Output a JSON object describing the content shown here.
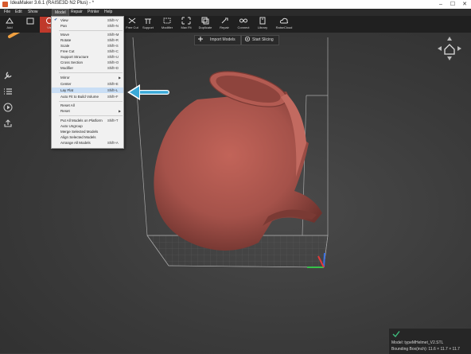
{
  "window": {
    "title": "IdeaMaker 3.6.1 (RAISE3D N2 Plus) - *",
    "controls": {
      "minimize": "–",
      "maximize": "☐",
      "close": "✕"
    }
  },
  "menubar": {
    "items": [
      "File",
      "Edit",
      "Show",
      "Model",
      "Repair",
      "Printer",
      "Help"
    ],
    "active": "Model"
  },
  "toolbar": {
    "items": [
      {
        "label": "Add",
        "icon": "add-model-icon"
      },
      {
        "label": "Free Cut",
        "icon": "free-cut-icon"
      },
      {
        "label": "Support",
        "icon": "support-icon"
      },
      {
        "label": "Modifier",
        "icon": "modifier-icon"
      },
      {
        "label": "Max Fit",
        "icon": "max-fit-icon"
      },
      {
        "label": "Duplicate",
        "icon": "duplicate-icon"
      },
      {
        "label": "Repair",
        "icon": "repair-icon"
      },
      {
        "label": "Connect",
        "icon": "connect-icon"
      },
      {
        "label": "Library",
        "icon": "library-icon"
      },
      {
        "label": "RaiseCloud",
        "icon": "cloud-icon"
      }
    ],
    "partial_label": "Vie"
  },
  "actions": {
    "import_models": "Import Models",
    "start_slicing": "Start Slicing"
  },
  "model_menu": {
    "items": [
      {
        "label": "View",
        "shortcut": "Shift+V",
        "checked": true
      },
      {
        "label": "Pan",
        "shortcut": "Shift+N"
      },
      {
        "label": "Move",
        "shortcut": "Shift+M"
      },
      {
        "label": "Rotate",
        "shortcut": "Shift+R"
      },
      {
        "label": "Scale",
        "shortcut": "Shift+S"
      },
      {
        "label": "Free Cut",
        "shortcut": "Shift+C"
      },
      {
        "label": "Support Structure",
        "shortcut": "Shift+U"
      },
      {
        "label": "Cross Section",
        "shortcut": "Shift+O"
      },
      {
        "label": "Modifier",
        "shortcut": "Shift+D"
      },
      {
        "label": "Mirror",
        "submenu": true
      },
      {
        "label": "Center",
        "shortcut": "Shift+E"
      },
      {
        "label": "Lay Flat",
        "shortcut": "Shift+L",
        "highlighted": true
      },
      {
        "label": "Auto Fit to Build Volume",
        "shortcut": "Shift+F"
      },
      {
        "label": "Reset All"
      },
      {
        "label": "Reset",
        "submenu": true
      },
      {
        "label": "Put All Models on Platform",
        "shortcut": "Shift+T"
      },
      {
        "label": "Auto Ungroup"
      },
      {
        "label": "Merge Selected Models"
      },
      {
        "label": "Align Selected Models"
      },
      {
        "label": "Arrange All Models",
        "shortcut": "Shift+A"
      }
    ]
  },
  "status": {
    "model": "Model: typeMHelmet_V2.STL",
    "bounding_box": "Bounding Box(inch): 11.6 × 11.7 × 11.7"
  },
  "colors": {
    "model": "#a5524a",
    "arrow_orange": "#f0a040",
    "arrow_blue": "#3aa9d8",
    "highlight": "#c9def5"
  }
}
